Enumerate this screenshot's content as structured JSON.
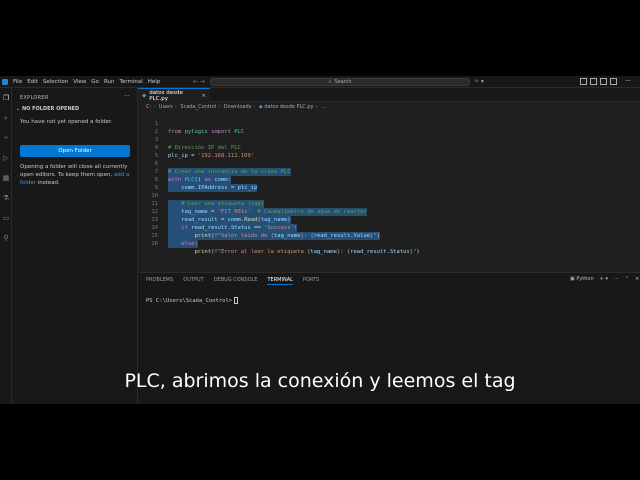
{
  "menu": [
    "File",
    "Edit",
    "Selection",
    "View",
    "Go",
    "Run",
    "Terminal",
    "Help"
  ],
  "search": {
    "label": "Search"
  },
  "sidebar": {
    "title": "EXPLORER",
    "section": "NO FOLDER OPENED",
    "no_folder_text": "You have not yet opened a folder.",
    "open_button": "Open Folder",
    "para_1": "Opening a folder will close all currently",
    "para_2": "open editors. To keep them open,",
    "para_link_1": "add a",
    "para_link_2": "folder",
    "para_3": "instead."
  },
  "tab": {
    "label": "datos desde PLC.py"
  },
  "breadcrumb": [
    "C:",
    "Users",
    "Scada_Control",
    "Downloads",
    "datos desde PLC.py",
    "..."
  ],
  "code_lines": [
    {
      "num": "1",
      "text": "from pylogix import PLC"
    },
    {
      "num": "2",
      "text": ""
    },
    {
      "num": "3",
      "text": "# Dirección IP del PLC"
    },
    {
      "num": "4",
      "text": "plc_ip = '192.168.112.109'"
    },
    {
      "num": "5",
      "text": ""
    },
    {
      "num": "6",
      "text": "# Crear una instancia de la clase PLC"
    },
    {
      "num": "7",
      "text": "with PLC() as comm:"
    },
    {
      "num": "8",
      "text": "    comm.IPAddress = plc_ip"
    },
    {
      "num": "9",
      "text": ""
    },
    {
      "num": "10",
      "text": "    # Leer una etiqueta (tag)"
    },
    {
      "num": "11",
      "text": "    tag_name = 'FIT_001s'  # Caudalimetro de agua de reactor"
    },
    {
      "num": "12",
      "text": "    read_result = comm.Read(tag_name)"
    },
    {
      "num": "13",
      "text": "    if read_result.Status == 'Success':"
    },
    {
      "num": "14",
      "text": "        print(f\"Valor leído de {tag_name}: {read_result.Value}\")"
    },
    {
      "num": "15",
      "text": "    else:"
    },
    {
      "num": "16",
      "text": "        print(f\"Error al leer la etiqueta {tag_name}: {read_result.Status}\")"
    }
  ],
  "panel": {
    "tabs": [
      "PROBLEMS",
      "OUTPUT",
      "DEBUG CONSOLE",
      "TERMINAL",
      "PORTS"
    ],
    "shell": "Python",
    "prompt": "PS C:\\Users\\Scada_Control>"
  },
  "caption": "PLC, abrimos la conexión y leemos el tag"
}
